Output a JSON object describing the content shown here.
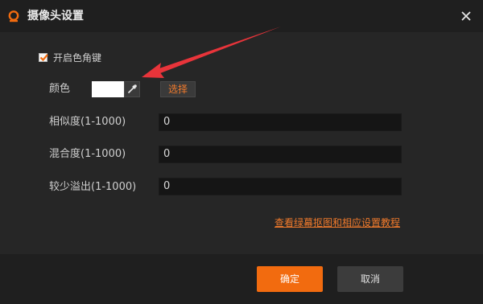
{
  "window": {
    "title": "摄像头设置",
    "logo_icon": "camera-logo-icon",
    "close_icon": "close-icon"
  },
  "chroma_key": {
    "checkbox_label": "开启色角键",
    "checked": true
  },
  "color_row": {
    "label": "颜色",
    "swatch_color": "#ffffff",
    "picker_icon": "eyedropper-icon",
    "select_label": "选择"
  },
  "fields": [
    {
      "label": "相似度(1-1000)",
      "value": "0"
    },
    {
      "label": "混合度(1-1000)",
      "value": "0"
    },
    {
      "label": "较少溢出(1-1000)",
      "value": "0"
    }
  ],
  "tutorial_link": "查看绿幕抠图和相应设置教程",
  "buttons": {
    "ok": "确定",
    "cancel": "取消"
  },
  "colors": {
    "accent": "#f26b0f",
    "annotation_arrow": "#e8343a"
  }
}
